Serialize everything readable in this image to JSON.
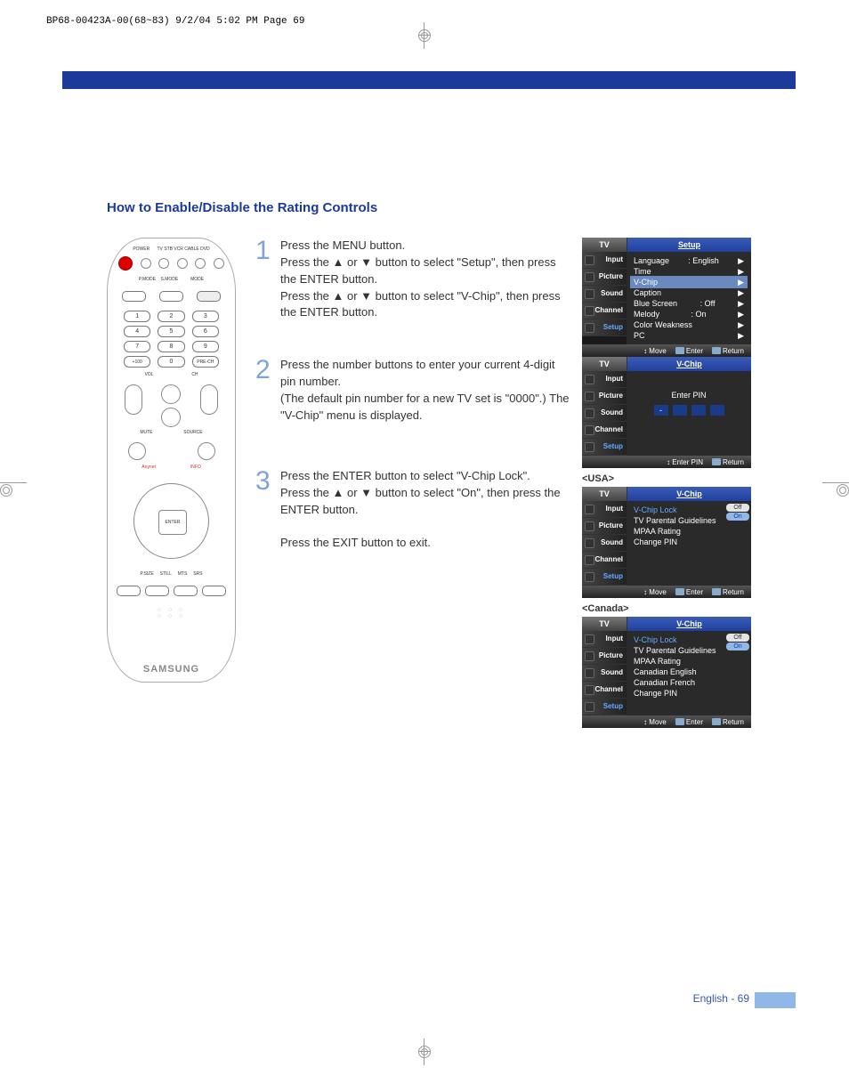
{
  "print_header": "BP68-00423A-00(68~83)  9/2/04  5:02 PM  Page 69",
  "title": "How to Enable/Disable the Rating Controls",
  "remote_brand": "SAMSUNG",
  "remote_enter": "ENTER",
  "steps": [
    {
      "num": "1",
      "text": "Press the MENU button.\nPress the ▲ or ▼ button to select \"Setup\", then press the ENTER button.\nPress the ▲ or ▼ button to select \"V-Chip\", then press the ENTER button."
    },
    {
      "num": "2",
      "text": "Press the number buttons to enter your current 4-digit pin number.\n(The default pin number for a new TV set is \"0000\".) The \"V-Chip\" menu is displayed."
    },
    {
      "num": "3",
      "text": "Press the ENTER button to select \"V-Chip Lock\".\nPress the ▲ or ▼ button to select \"On\", then press the ENTER button.\n\nPress the EXIT button to exit."
    }
  ],
  "osd_side": [
    "Input",
    "Picture",
    "Sound",
    "Channel",
    "Setup"
  ],
  "osd_tv": "TV",
  "osd1": {
    "title": "Setup",
    "rows": [
      [
        "Language",
        ": English"
      ],
      [
        "Time",
        ""
      ],
      [
        "V-Chip",
        ""
      ],
      [
        "Caption",
        ""
      ],
      [
        "Blue Screen",
        ": Off"
      ],
      [
        "Melody",
        ": On"
      ],
      [
        "Color Weakness",
        ""
      ],
      [
        "PC",
        ""
      ]
    ],
    "foot": [
      "Move",
      "Enter",
      "Return"
    ]
  },
  "osd2": {
    "title": "V-Chip",
    "enter_pin": "Enter PIN",
    "foot": [
      "Enter PIN",
      "Return"
    ]
  },
  "usa_label": "<USA>",
  "osd3": {
    "title": "V-Chip",
    "rows": [
      "V-Chip Lock",
      "TV Parental Guidelines",
      "MPAA Rating",
      "Change PIN"
    ],
    "on": "On",
    "off": "Off",
    "foot": [
      "Move",
      "Enter",
      "Return"
    ]
  },
  "canada_label": "<Canada>",
  "osd4": {
    "title": "V-Chip",
    "rows": [
      "V-Chip Lock",
      "TV Parental Guidelines",
      "MPAA Rating",
      "Canadian English",
      "Canadian French",
      "Change PIN"
    ],
    "on": "On",
    "off": "Off",
    "foot": [
      "Move",
      "Enter",
      "Return"
    ]
  },
  "page_foot": "English - 69"
}
